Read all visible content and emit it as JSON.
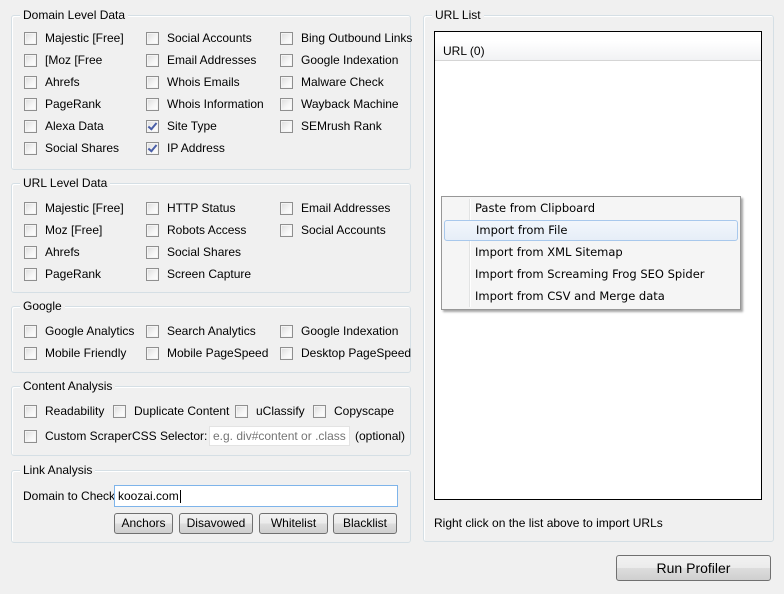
{
  "domain_level": {
    "title": "Domain Level Data",
    "items": [
      {
        "label": "Majestic [Free]",
        "checked": false
      },
      {
        "label": "[Moz [Free",
        "checked": false
      },
      {
        "label": "Ahrefs",
        "checked": false
      },
      {
        "label": "PageRank",
        "checked": false
      },
      {
        "label": "Alexa Data",
        "checked": false
      },
      {
        "label": "Social Shares",
        "checked": false
      },
      {
        "label": "Social Accounts",
        "checked": false
      },
      {
        "label": "Email Addresses",
        "checked": false
      },
      {
        "label": "Whois Emails",
        "checked": false
      },
      {
        "label": "Whois Information",
        "checked": false
      },
      {
        "label": "Site Type",
        "checked": true
      },
      {
        "label": "IP Address",
        "checked": true
      },
      {
        "label": "Bing Outbound Links",
        "checked": false
      },
      {
        "label": "Google Indexation",
        "checked": false
      },
      {
        "label": "Malware Check",
        "checked": false
      },
      {
        "label": "Wayback Machine",
        "checked": false
      },
      {
        "label": "SEMrush Rank",
        "checked": false
      }
    ]
  },
  "url_level": {
    "title": "URL Level Data",
    "items": [
      {
        "label": "Majestic [Free]",
        "checked": false
      },
      {
        "label": "Moz [Free]",
        "checked": false
      },
      {
        "label": "Ahrefs",
        "checked": false
      },
      {
        "label": "PageRank",
        "checked": false
      },
      {
        "label": "HTTP Status",
        "checked": false
      },
      {
        "label": "Robots Access",
        "checked": false
      },
      {
        "label": "Social Shares",
        "checked": false
      },
      {
        "label": "Screen Capture",
        "checked": false
      },
      {
        "label": "Email Addresses",
        "checked": false
      },
      {
        "label": "Social Accounts",
        "checked": false
      }
    ]
  },
  "google": {
    "title": "Google",
    "items": [
      {
        "label": "Google Analytics",
        "checked": false
      },
      {
        "label": "Mobile Friendly",
        "checked": false
      },
      {
        "label": "Search Analytics",
        "checked": false
      },
      {
        "label": "Mobile PageSpeed",
        "checked": false
      },
      {
        "label": "Google Indexation",
        "checked": false
      },
      {
        "label": "Desktop PageSpeed",
        "checked": false
      }
    ]
  },
  "content_analysis": {
    "title": "Content Analysis",
    "items": [
      {
        "label": "Readability",
        "checked": false
      },
      {
        "label": "Duplicate Content",
        "checked": false
      },
      {
        "label": "uClassify",
        "checked": false
      },
      {
        "label": "Copyscape",
        "checked": false
      },
      {
        "label": "Custom Scraper",
        "checked": false
      }
    ],
    "css_selector_label": "CSS Selector:",
    "css_selector_value": "",
    "css_selector_placeholder": "e.g. div#content or .class-na",
    "optional_label": "(optional)"
  },
  "link_analysis": {
    "title": "Link Analysis",
    "domain_label": "Domain to Check:",
    "domain_value": "koozai.com",
    "buttons": [
      "Anchors",
      "Disavowed",
      "Whitelist",
      "Blacklist"
    ]
  },
  "url_list": {
    "title": "URL List",
    "column_header": "URL (0)",
    "hint": "Right click on the list above to import URLs"
  },
  "context_menu": {
    "items": [
      "Paste from Clipboard",
      "Import from File",
      "Import from XML Sitemap",
      "Import from Screaming Frog SEO Spider",
      "Import from CSV and Merge data"
    ],
    "highlighted_index": 1
  },
  "run_button": "Run Profiler"
}
